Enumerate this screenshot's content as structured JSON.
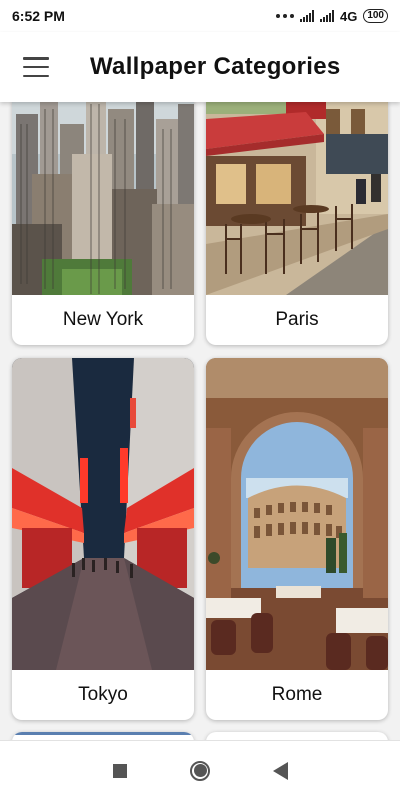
{
  "status_bar": {
    "time": "6:52 PM",
    "network": "4G",
    "battery": "100"
  },
  "app_bar": {
    "title": "Wallpaper Categories",
    "menu_icon": "hamburger-menu-icon"
  },
  "categories": [
    {
      "label": "New York",
      "image": "new-york-skyline-photo"
    },
    {
      "label": "Paris",
      "image": "paris-cafe-street-photo"
    },
    {
      "label": "Tokyo",
      "image": "tokyo-neon-street-photo"
    },
    {
      "label": "Rome",
      "image": "rome-colosseum-arch-photo"
    }
  ],
  "nav_bar": {
    "icons": [
      "recent-apps-icon",
      "home-icon",
      "back-icon"
    ]
  },
  "colors": {
    "background": "#f2f2f2",
    "card": "#ffffff",
    "text": "#111111",
    "nav_icon": "#555555"
  }
}
